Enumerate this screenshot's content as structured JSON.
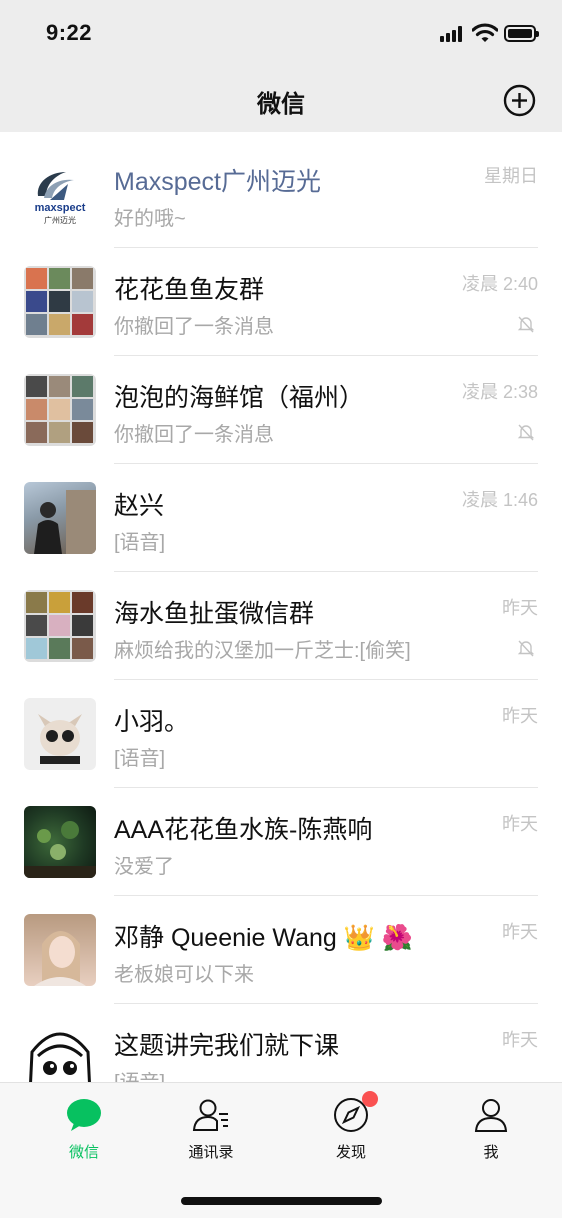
{
  "status_bar": {
    "time": "9:22"
  },
  "header": {
    "title": "微信"
  },
  "chats": [
    {
      "name": "Maxspect广州迈光",
      "preview": "好的哦~",
      "time": "星期日",
      "muted": false,
      "official": true,
      "avatar": "maxspect-logo",
      "logo_text": "maxspect",
      "logo_sub": "广州迈光"
    },
    {
      "name": "花花鱼鱼友群",
      "preview": "你撤回了一条消息",
      "time": "凌晨 2:40",
      "muted": true,
      "avatar": "group-grid"
    },
    {
      "name": "泡泡的海鲜馆（福州）",
      "preview": "你撤回了一条消息",
      "time": "凌晨 2:38",
      "muted": true,
      "avatar": "group-grid"
    },
    {
      "name": "赵兴",
      "preview": "[语音]",
      "time": "凌晨 1:46",
      "muted": false,
      "avatar": "photo-person"
    },
    {
      "name": "海水鱼扯蛋微信群",
      "preview": "麻烦给我的汉堡加一斤芝士:[偷笑]",
      "time": "昨天",
      "muted": true,
      "avatar": "group-grid"
    },
    {
      "name": "小羽。",
      "preview": "[语音]",
      "time": "昨天",
      "muted": false,
      "avatar": "photo-dog"
    },
    {
      "name": "AAA花花鱼水族-陈燕响",
      "preview": "没爱了",
      "time": "昨天",
      "muted": false,
      "avatar": "photo-aquarium"
    },
    {
      "name": "邓静 Queenie Wang 👑 🌺",
      "preview": "老板娘可以下来",
      "time": "昨天",
      "muted": false,
      "avatar": "photo-woman"
    },
    {
      "name": "这题讲完我们就下课",
      "preview": "[语音]",
      "time": "昨天",
      "muted": false,
      "avatar": "anime-drawing"
    }
  ],
  "tabbar": {
    "tabs": [
      {
        "label": "微信",
        "icon": "chat-bubble-icon",
        "active": true
      },
      {
        "label": "通讯录",
        "icon": "contacts-icon",
        "active": false
      },
      {
        "label": "发现",
        "icon": "compass-icon",
        "active": false,
        "badge_dot": true
      },
      {
        "label": "我",
        "icon": "person-icon",
        "active": false
      }
    ]
  },
  "colors": {
    "accent": "#07c160",
    "badge": "#fa5151",
    "official_name": "#576b95",
    "header_bg": "#ededed"
  }
}
